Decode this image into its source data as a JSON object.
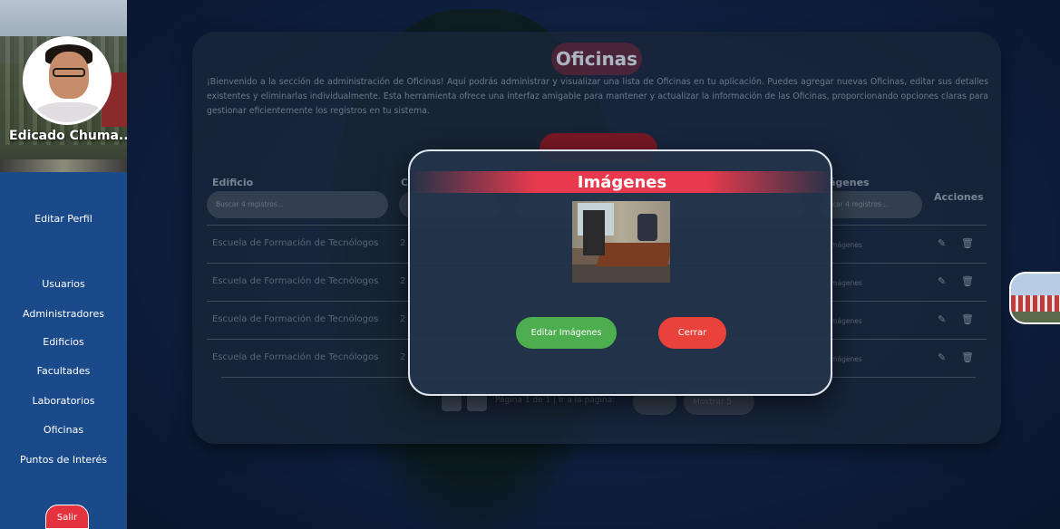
{
  "sidebar": {
    "user_name": "Edicado Chuma...",
    "edit_profile": "Editar Perfil",
    "items": [
      {
        "label": "Usuarios"
      },
      {
        "label": "Administradores"
      },
      {
        "label": "Edificios"
      },
      {
        "label": "Facultades"
      },
      {
        "label": "Laboratorios"
      },
      {
        "label": "Oficinas"
      },
      {
        "label": "Puntos de Interés"
      }
    ],
    "logout": "Salir"
  },
  "page": {
    "title": "Oficinas",
    "description": "¡Bienvenido a la sección de administración de Oficinas! Aquí podrás administrar y visualizar una lista de Oficinas en tu aplicación. Puedes agregar nuevas Oficinas, editar sus detalles existentes y eliminarlas individualmente. Esta herramienta ofrece una interfaz amigable para mantener y actualizar la información de las Oficinas, proporcionando opciones claras para gestionar eficientemente los registros en tu sistema."
  },
  "table": {
    "headers": {
      "edificio": "Edificio",
      "col2": "C",
      "imagenes": "ágenes",
      "acciones": "Acciones"
    },
    "filter_placeholder": "Buscar 4 registros...",
    "filter_placeholder_right": "scar 4 registros...",
    "rows": [
      {
        "edificio": "Escuela de Formación de Tecnólogos",
        "col2": "2",
        "imagenes": "Imágenes"
      },
      {
        "edificio": "Escuela de Formación de Tecnólogos",
        "col2": "2",
        "imagenes": "Imágenes"
      },
      {
        "edificio": "Escuela de Formación de Tecnólogos",
        "col2": "2",
        "imagenes": "Imágenes"
      },
      {
        "edificio": "Escuela de Formación de Tecnólogos",
        "col2": "2",
        "imagenes": "Imágenes"
      }
    ],
    "pager_text": "Página 1 de 1 | Ir a la página:",
    "pager_pill_right": "Mostrar 5"
  },
  "modal": {
    "title": "Imágenes",
    "edit_button": "Editar Imágenes",
    "close_button": "Cerrar"
  },
  "icons": {
    "edit": "edit-icon",
    "delete": "trash-icon"
  },
  "colors": {
    "sidebar": "#1b4a8a",
    "modal_band": "#e83a4c",
    "edit_btn": "#4cae4f",
    "close_btn": "#e8423a",
    "logout_btn": "#e4333e"
  }
}
